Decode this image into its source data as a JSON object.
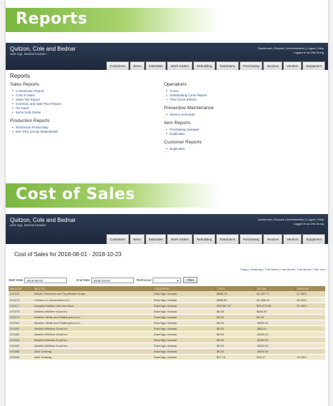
{
  "banners": {
    "reports": "Reports",
    "cost_of_sales": "Cost of Sales"
  },
  "app": {
    "company": "Quitzon, Cole and Bednar",
    "location": "east nga, kansas location",
    "toplinks": "Dashboard | Reports | Administration | Logout | Help",
    "logged_in": "Logged in as Otis Xiong",
    "tabs": [
      "Customers",
      "Items",
      "Estimates",
      "Work Orders",
      "Rebuilding",
      "Teardowns",
      "Purchasing",
      "Invoices",
      "Vendors",
      "Equipment"
    ]
  },
  "reports": {
    "heading": "Reports",
    "sales": {
      "title": "Sales Reports",
      "items": [
        "Commission Report",
        "Cost of Sales",
        "Sales Tax Report",
        "Inventory and Sale Price Report",
        "On Hand",
        "Items Sold Online"
      ]
    },
    "production": {
      "title": "Production Reports",
      "items": [
        "Technician Productivity",
        "Item Pick List By Make/Model"
      ]
    },
    "operations": {
      "title": "Operations",
      "items": [
        "Cores",
        "Outstanding Cores Report",
        "Time Clock Entries"
      ]
    },
    "preventive": {
      "title": "Preventive Maintenance",
      "items": [
        "Service Schedule"
      ]
    },
    "item_reports": {
      "title": "Item Reports",
      "items": [
        "Purchasing Sweeper",
        "Duplicates"
      ]
    },
    "customer_reports": {
      "title": "Customer Reports",
      "items": [
        "Duplicates"
      ]
    }
  },
  "cost_of_sales": {
    "title": "Cost of Sales for 2018-08-01 - 2018-10-23",
    "quick_links": "Today | Yesterday | This Week | Last Month | This Month | This Year",
    "start_label": "Start Date",
    "start_value": "2018-08-01",
    "end_label": "End Date",
    "end_value": "2018-10-23",
    "tech_label": "Technician",
    "tech_value": "",
    "filter_button": "Filter",
    "columns": [
      "INVOICE",
      "BILL TO",
      "LOCATION",
      "COST",
      "RETAIL",
      "MARGIN"
    ],
    "rows": [
      [
        "031640",
        "Abbott, Grimsson and Toy Marine Group",
        "East Nga, Kansas",
        "$886.74",
        "$1,207.77",
        "21.36%"
      ],
      [
        "031674",
        "O'Kara LLC Accountant LLC",
        "East Nga, Kansas",
        "$856.60",
        "$1,908.00",
        "35.00%"
      ],
      [
        "031677",
        "Douglas-Rolfsen Veit and Sons",
        "East Nga, Kansas",
        "$16,367.57",
        "$20,273.00",
        "37.46%"
      ],
      [
        "031678",
        "Abshire-Wildrice Good Inc",
        "East Nga, Kansas",
        "$0.00",
        "$100.00",
        ""
      ],
      [
        "031679",
        "Abshire, White and Padberg Act LLC",
        "East Nga, Kansas",
        "$0.00",
        "$0.00",
        ""
      ],
      [
        "031680",
        "Abshire, White and Padberg Act LLC",
        "East Nga, Kansas",
        "$0.00",
        "-$250.00",
        ""
      ],
      [
        "031681",
        "Abshire-Wildrice Good Inc",
        "East Nga, Kansas",
        "$0.00",
        "-$50.00",
        ""
      ],
      [
        "031682",
        "Abshire-Wildrice Good Inc",
        "East Nga, Kansas",
        "$0.00",
        "-$100.00",
        ""
      ],
      [
        "031683",
        "Abshire-Wildrice Good Inc",
        "East Nga, Kansas",
        "$0.00",
        "-$100.00",
        ""
      ],
      [
        "031684",
        "Abshire-Wildrice Good Inc",
        "East Nga, Kansas",
        "$0.00",
        "-$100.00",
        ""
      ],
      [
        "031685",
        "AAA Trucking",
        "East Nga, Kansas",
        "$0.00",
        "-$500.00",
        ""
      ],
      [
        "031686",
        "AAA Trucking",
        "East Nga, Kansas",
        "$17.15",
        "$15.07",
        "13.18%"
      ]
    ]
  }
}
